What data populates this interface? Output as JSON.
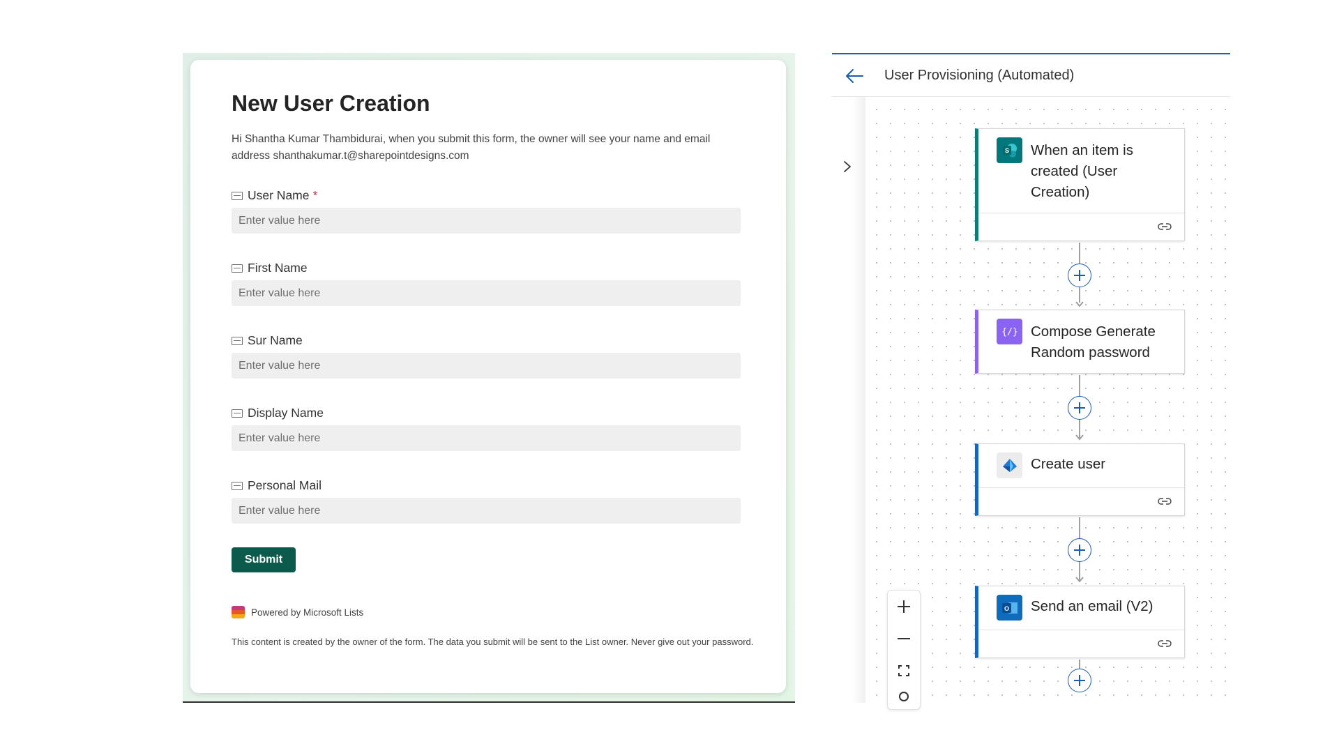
{
  "form": {
    "title": "New User Creation",
    "description": "Hi Shantha Kumar Thambidurai, when you submit this form, the owner will see your name and email address shanthakumar.t@sharepointdesigns.com",
    "required_marker": "*",
    "fields": [
      {
        "label": "User Name",
        "placeholder": "Enter value here",
        "required": true
      },
      {
        "label": "First Name",
        "placeholder": "Enter value here",
        "required": false
      },
      {
        "label": "Sur Name",
        "placeholder": "Enter value here",
        "required": false
      },
      {
        "label": "Display Name",
        "placeholder": "Enter value here",
        "required": false
      },
      {
        "label": "Personal Mail",
        "placeholder": "Enter value here",
        "required": false
      }
    ],
    "submit_label": "Submit",
    "powered_by": "Powered by Microsoft Lists",
    "footer": "This content is created by the owner of the form. The data you submit will be sent to the List owner. Never give out your password.",
    "brand_color": "#0b5a4b"
  },
  "flow": {
    "title": "User Provisioning (Automated)",
    "accent": "#1a5bb0",
    "steps": [
      {
        "title": "When an item is created (User Creation)",
        "icon": "sharepoint-icon",
        "accent": "#0a7d76",
        "has_footer": true
      },
      {
        "title": "Compose Generate Random password",
        "icon": "compose-icon",
        "accent": "#8a63f0",
        "has_footer": false
      },
      {
        "title": "Create user",
        "icon": "entra-id-icon",
        "accent": "#1565c0",
        "has_footer": true
      },
      {
        "title": "Send an email (V2)",
        "icon": "outlook-icon",
        "accent": "#1565c0",
        "has_footer": true
      }
    ],
    "zoom_controls": [
      "zoom-in-icon",
      "zoom-out-icon",
      "fit-view-icon",
      "search-icon"
    ]
  }
}
